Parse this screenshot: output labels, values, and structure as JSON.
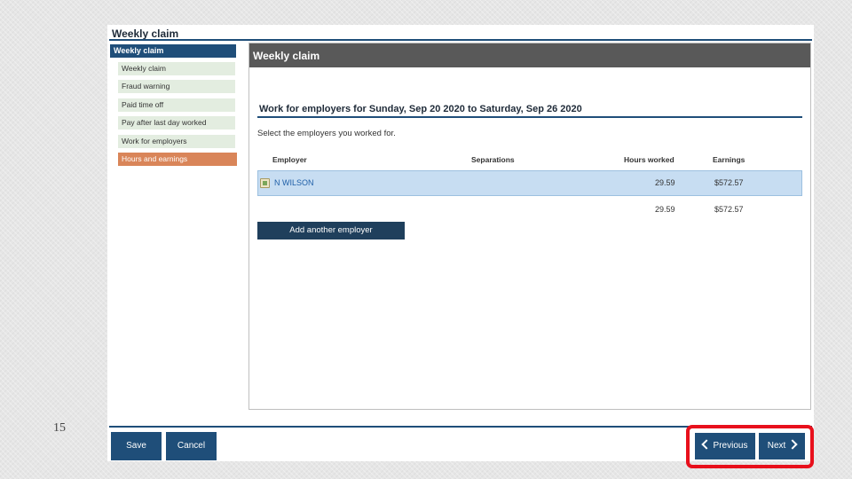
{
  "app": {
    "title": "Weekly claim"
  },
  "sidebar": {
    "header": "Weekly claim",
    "items": [
      {
        "label": "Weekly claim"
      },
      {
        "label": "Fraud warning"
      },
      {
        "label": "Paid time off"
      },
      {
        "label": "Pay after last day worked"
      },
      {
        "label": "Work for employers"
      },
      {
        "label": "Hours and earnings",
        "active": true
      }
    ]
  },
  "panel": {
    "header": "Weekly claim",
    "section_title": "Work for employers for Sunday, Sep 20 2020 to Saturday, Sep 26 2020",
    "instruction": "Select the employers you worked for.",
    "columns": [
      "Employer",
      "Separations",
      "Hours worked",
      "Earnings"
    ],
    "rows": [
      {
        "employer": "N WILSON",
        "separations": "",
        "hours": "29.59",
        "earnings": "$572.57"
      }
    ],
    "totals": {
      "hours": "29.59",
      "earnings": "$572.57"
    },
    "add_button": "Add another employer"
  },
  "footer": {
    "save": "Save",
    "cancel": "Cancel",
    "previous": "Previous",
    "next": "Next"
  },
  "slide_number": "15",
  "colors": {
    "navy": "#1f4e79",
    "active_step": "#d98559",
    "step_bg": "#e3ede0",
    "row_selected": "#c7ddf2",
    "highlight": "#e8101c"
  }
}
